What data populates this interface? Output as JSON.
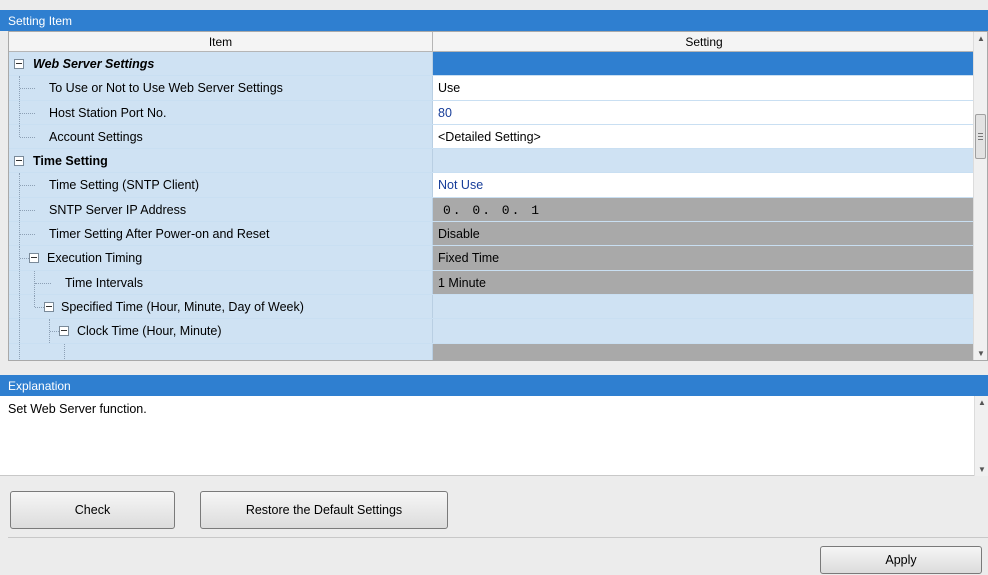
{
  "setting_panel": {
    "title": "Setting Item",
    "columns": {
      "item": "Item",
      "setting": "Setting"
    },
    "rows": [
      {
        "label": "Web Server Settings",
        "value": ""
      },
      {
        "label": "To Use or Not to Use Web Server Settings",
        "value": "Use"
      },
      {
        "label": "Host Station Port No.",
        "value": "80"
      },
      {
        "label": "Account Settings",
        "value": "<Detailed Setting>"
      },
      {
        "label": "Time Setting",
        "value": ""
      },
      {
        "label": "Time Setting (SNTP Client)",
        "value": "Not Use"
      },
      {
        "label": "SNTP Server IP Address",
        "value": "0. 0. 0. 1"
      },
      {
        "label": "Timer Setting After Power-on and Reset",
        "value": "Disable"
      },
      {
        "label": "Execution Timing",
        "value": "Fixed Time"
      },
      {
        "label": "Time Intervals",
        "value": "1 Minute"
      },
      {
        "label": "Specified Time (Hour, Minute, Day of Week)",
        "value": ""
      },
      {
        "label": "Clock Time (Hour, Minute)",
        "value": ""
      }
    ]
  },
  "explanation": {
    "title": "Explanation",
    "text": "Set Web Server function."
  },
  "buttons": {
    "check": "Check",
    "restore": "Restore the Default Settings",
    "apply": "Apply"
  },
  "colors": {
    "header_blue": "#2f7fd0",
    "row_blue": "#cfe2f3",
    "disabled_gray": "#a9a9a9",
    "value_blue_text": "#173d99"
  },
  "icons": {
    "expand_toggle": "collapse-minus-icon",
    "scroll_up": "scroll-up-arrow-icon",
    "scroll_down": "scroll-down-arrow-icon"
  }
}
